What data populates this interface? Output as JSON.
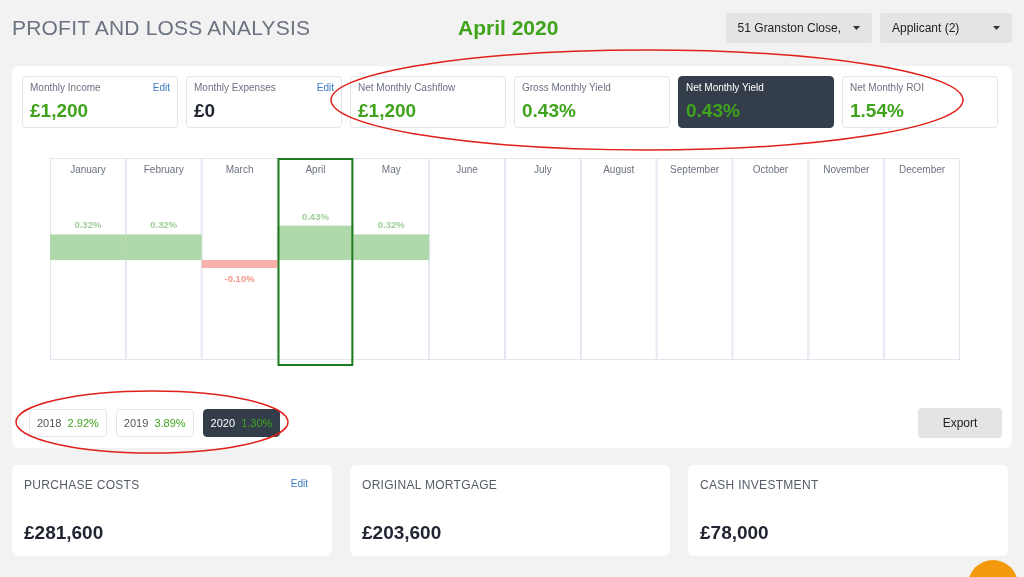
{
  "header": {
    "title": "PROFIT AND LOSS ANALYSIS",
    "period": "April 2020",
    "dropdowns": [
      {
        "label": "51 Granston Close,"
      },
      {
        "label": "Applicant (2)"
      }
    ]
  },
  "stats": [
    {
      "label": "Monthly Income",
      "edit": "Edit",
      "value": "£1,200",
      "kind": "positive",
      "selected": false
    },
    {
      "label": "Monthly Expenses",
      "edit": "Edit",
      "value": "£0",
      "kind": "neutral",
      "selected": false
    },
    {
      "label": "Net Monthly Cashflow",
      "value": "£1,200",
      "kind": "positive",
      "selected": false
    },
    {
      "label": "Gross Monthly Yield",
      "value": "0.43%",
      "kind": "positive",
      "selected": false
    },
    {
      "label": "Net Monthly Yield",
      "value": "0.43%",
      "kind": "positive",
      "selected": true
    },
    {
      "label": "Net Monthly ROI",
      "value": "1.54%",
      "kind": "positive",
      "selected": false
    }
  ],
  "chart": {
    "highlight": [
      false,
      false,
      false,
      true,
      false,
      false,
      false,
      false,
      false,
      false,
      false,
      false
    ],
    "chart_data": {
      "type": "bar",
      "categories": [
        "January",
        "February",
        "March",
        "April",
        "May",
        "June",
        "July",
        "August",
        "September",
        "October",
        "November",
        "December"
      ],
      "values": [
        0.32,
        0.32,
        -0.1,
        0.43,
        0.32,
        null,
        null,
        null,
        null,
        null,
        null,
        null
      ],
      "data_labels": true,
      "value_labels": [
        "0.32%",
        "0.32%",
        "-0.10%",
        "0.43%",
        "0.32%",
        null,
        null,
        null,
        null,
        null,
        null,
        null
      ]
    }
  },
  "years": [
    {
      "year": "2018",
      "value": "2.92%",
      "selected": false
    },
    {
      "year": "2019",
      "value": "3.89%",
      "selected": false
    },
    {
      "year": "2020",
      "value": "1.30%",
      "selected": true
    }
  ],
  "export": "Export",
  "summary": [
    {
      "title": "PURCHASE COSTS",
      "edit": "Edit",
      "value": "£281,600"
    },
    {
      "title": "ORIGINAL MORTGAGE",
      "value": "£203,600"
    },
    {
      "title": "CASH INVESTMENT",
      "value": "£78,000"
    }
  ]
}
